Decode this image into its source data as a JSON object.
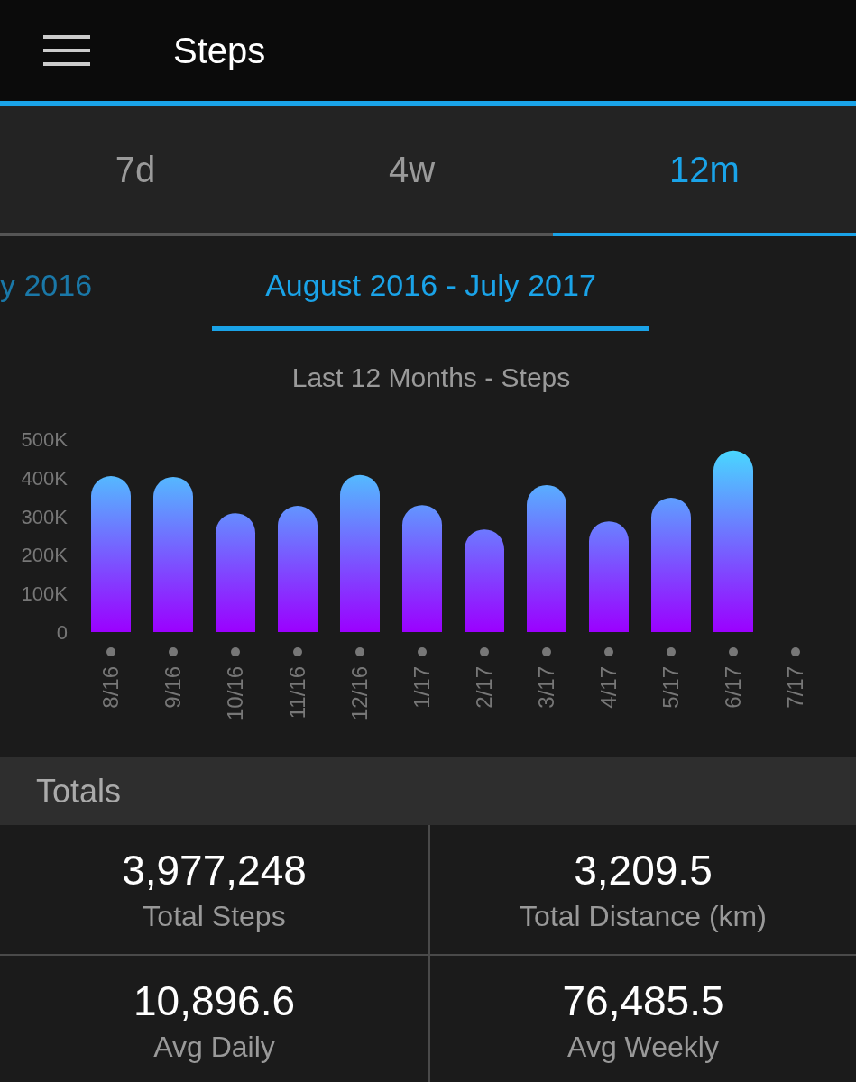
{
  "app_bar": {
    "title": "Steps"
  },
  "tabs": [
    {
      "label": "7d",
      "selected": false
    },
    {
      "label": "4w",
      "selected": false
    },
    {
      "label": "12m",
      "selected": true
    }
  ],
  "periods": [
    {
      "label": "y 2016",
      "selected": false
    },
    {
      "label": "August 2016 - July 2017",
      "selected": true
    }
  ],
  "chart": {
    "chart_data": {
      "type": "bar",
      "title": "Last 12 Months - Steps",
      "categories": [
        "8/16",
        "9/16",
        "10/16",
        "11/16",
        "12/16",
        "1/17",
        "2/17",
        "3/17",
        "4/17",
        "5/17",
        "6/17",
        "7/17"
      ],
      "series": [
        {
          "values": [
            404000,
            402000,
            308000,
            327000,
            407000,
            329000,
            266000,
            381000,
            287000,
            348000,
            470000,
            null
          ]
        }
      ],
      "ylim": [
        0,
        500000
      ],
      "yticks": [
        {
          "value": 0,
          "label": "0"
        },
        {
          "value": 100000,
          "label": "100K"
        },
        {
          "value": 200000,
          "label": "200K"
        },
        {
          "value": 300000,
          "label": "300K"
        },
        {
          "value": 400000,
          "label": "400K"
        },
        {
          "value": 500000,
          "label": "500K"
        }
      ]
    }
  },
  "totals": {
    "title": "Totals",
    "stats": [
      {
        "value": "3,977,248",
        "label": "Total Steps"
      },
      {
        "value": "3,209.5",
        "label": "Total Distance (km)"
      },
      {
        "value": "10,896.6",
        "label": "Avg Daily"
      },
      {
        "value": "76,485.5",
        "label": "Avg Weekly"
      }
    ]
  }
}
